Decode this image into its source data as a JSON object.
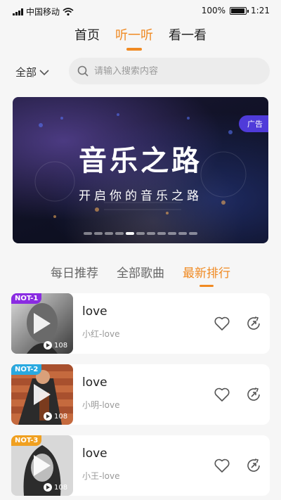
{
  "status_bar": {
    "carrier": "中国移动",
    "battery_text": "100%",
    "battery_level": 1.0,
    "time": "1:21"
  },
  "top_tabs": [
    {
      "label": "首页",
      "active": false
    },
    {
      "label": "听一听",
      "active": true
    },
    {
      "label": "看一看",
      "active": false
    }
  ],
  "filter": {
    "label": "全部"
  },
  "search": {
    "placeholder": "请输入搜索内容",
    "value": ""
  },
  "banner": {
    "title": "音乐之路",
    "subtitle": "开启你的音乐之路",
    "ad_badge": "广告",
    "dot_count": 11,
    "active_dot": 4
  },
  "sub_tabs": [
    {
      "label": "每日推荐",
      "active": false
    },
    {
      "label": "全部歌曲",
      "active": false
    },
    {
      "label": "最新排行",
      "active": true
    }
  ],
  "songs": [
    {
      "rank": "NOT-1",
      "rank_color": "#8a2be2",
      "title": "love",
      "artist": "小红-love",
      "plays": "108",
      "icon": "album-cover-man-singing"
    },
    {
      "rank": "NOT-2",
      "rank_color": "#29a9e0",
      "title": "love",
      "artist": "小明-love",
      "plays": "108",
      "icon": "album-cover-person-with-guitar"
    },
    {
      "rank": "NOT-3",
      "rank_color": "#f0a020",
      "title": "love",
      "artist": "小王-love",
      "plays": "108",
      "icon": "album-cover-woman-portrait"
    }
  ],
  "colors": {
    "accent": "#f08a22",
    "ad_badge": "#4f3bd9"
  }
}
